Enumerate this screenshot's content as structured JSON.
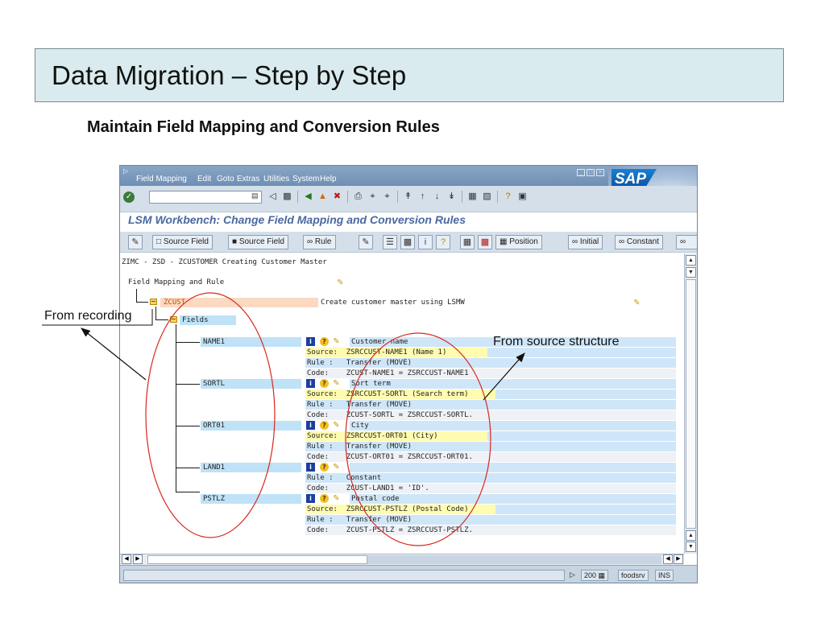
{
  "slide": {
    "title": "Data Migration – Step by Step",
    "subtitle": "Maintain Field Mapping and Conversion Rules"
  },
  "sap": {
    "menu": [
      {
        "label": "Field Mapping"
      },
      {
        "label": "Edit"
      },
      {
        "label": "Goto"
      },
      {
        "label": "Extras"
      },
      {
        "label": "Utilities"
      },
      {
        "label": "System"
      },
      {
        "label": "Help"
      }
    ],
    "logo": "SAP",
    "screen_title": "LSM Workbench: Change Field Mapping and Conversion Rules",
    "toolbar": {
      "source_field_1": "Source Field",
      "source_field_2": "Source Field",
      "rule": "Rule",
      "position": "Position",
      "initial": "Initial",
      "constant": "Constant"
    },
    "header_line": "ZIMC - ZSD - ZCUSTOMER Creating Customer Master",
    "field_mapping_label": "Field Mapping and Rule",
    "structure": {
      "name": "ZCUST",
      "description": "Create customer master using LSMW"
    },
    "fields_node": "Fields",
    "fields": [
      {
        "name": "NAME1",
        "description": "Customer name",
        "source": "Source:  ZSRCCUST-NAME1 (Name 1)",
        "rule": "Rule :   Transfer (MOVE)",
        "code": "Code:    ZCUST-NAME1 = ZSRCCUST-NAME1"
      },
      {
        "name": "SORTL",
        "description": "Sort term",
        "source": "Source:  ZSRCCUST-SORTL (Search term)",
        "rule": "Rule :   Transfer (MOVE)",
        "code": "Code:    ZCUST-SORTL = ZSRCCUST-SORTL."
      },
      {
        "name": "ORT01",
        "description": "City",
        "source": "Source:  ZSRCCUST-ORT01 (City)",
        "rule": "Rule :   Transfer (MOVE)",
        "code": "Code:    ZCUST-ORT01 = ZSRCCUST-ORT01."
      },
      {
        "name": "LAND1",
        "description": "",
        "rule": "Rule :   Constant",
        "code": "Code:    ZCUST-LAND1 = 'ID'."
      },
      {
        "name": "PSTLZ",
        "description": "Postal code",
        "source": "Source:  ZSRCCUST-PSTLZ (Postal Code)",
        "rule": "Rule :   Transfer (MOVE)",
        "code": "Code:    ZCUST-PSTLZ = ZSRCCUST-PSTLZ."
      }
    ],
    "status": {
      "client": "200",
      "server": "foodsrv",
      "mode": "INS"
    }
  },
  "annotations": {
    "from_recording": "From recording",
    "from_source_structure": "From source structure",
    "color": "#d9261c"
  }
}
